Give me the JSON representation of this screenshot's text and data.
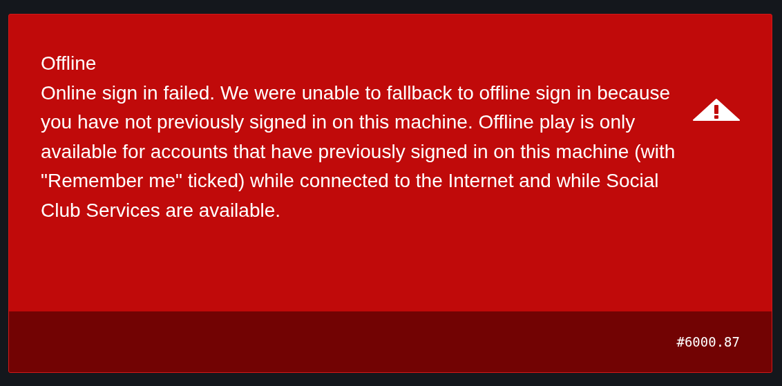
{
  "alert": {
    "title": "Offline",
    "message": "Online sign in failed. We were unable to fallback to offline sign in because you have not previously signed in on this machine. Offline play is only available for accounts that have previously signed in on this machine (with \"Remember me\" ticked) while connected to the Internet and while Social Club Services are available.",
    "code": "#6000.87"
  }
}
